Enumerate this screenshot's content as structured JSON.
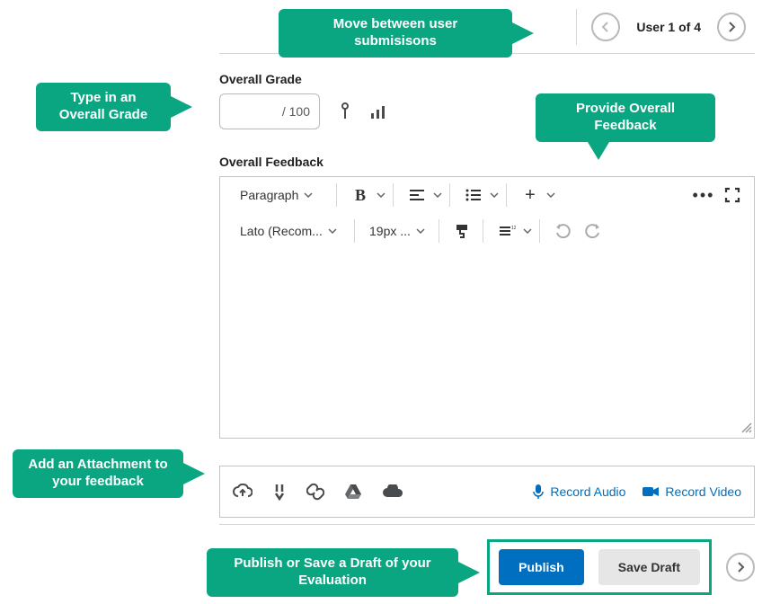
{
  "nav": {
    "user_counter": "User 1 of 4"
  },
  "grade": {
    "section_label": "Overall Grade",
    "value": "",
    "total": " / 100"
  },
  "feedback": {
    "section_label": "Overall Feedback"
  },
  "editor": {
    "block_format": "Paragraph",
    "font": "Lato (Recom...",
    "size": "19px ..."
  },
  "attach": {
    "record_audio": "Record Audio",
    "record_video": "Record Video"
  },
  "footer": {
    "publish": "Publish",
    "save_draft": "Save Draft"
  },
  "callouts": {
    "nav": "Move between user submisisons",
    "grade": "Type in an Overall Grade",
    "feedback": "Provide Overall Feedback",
    "attach": "Add an Attachment to your feedback",
    "actions": "Publish or Save a Draft of your Evaluation"
  }
}
